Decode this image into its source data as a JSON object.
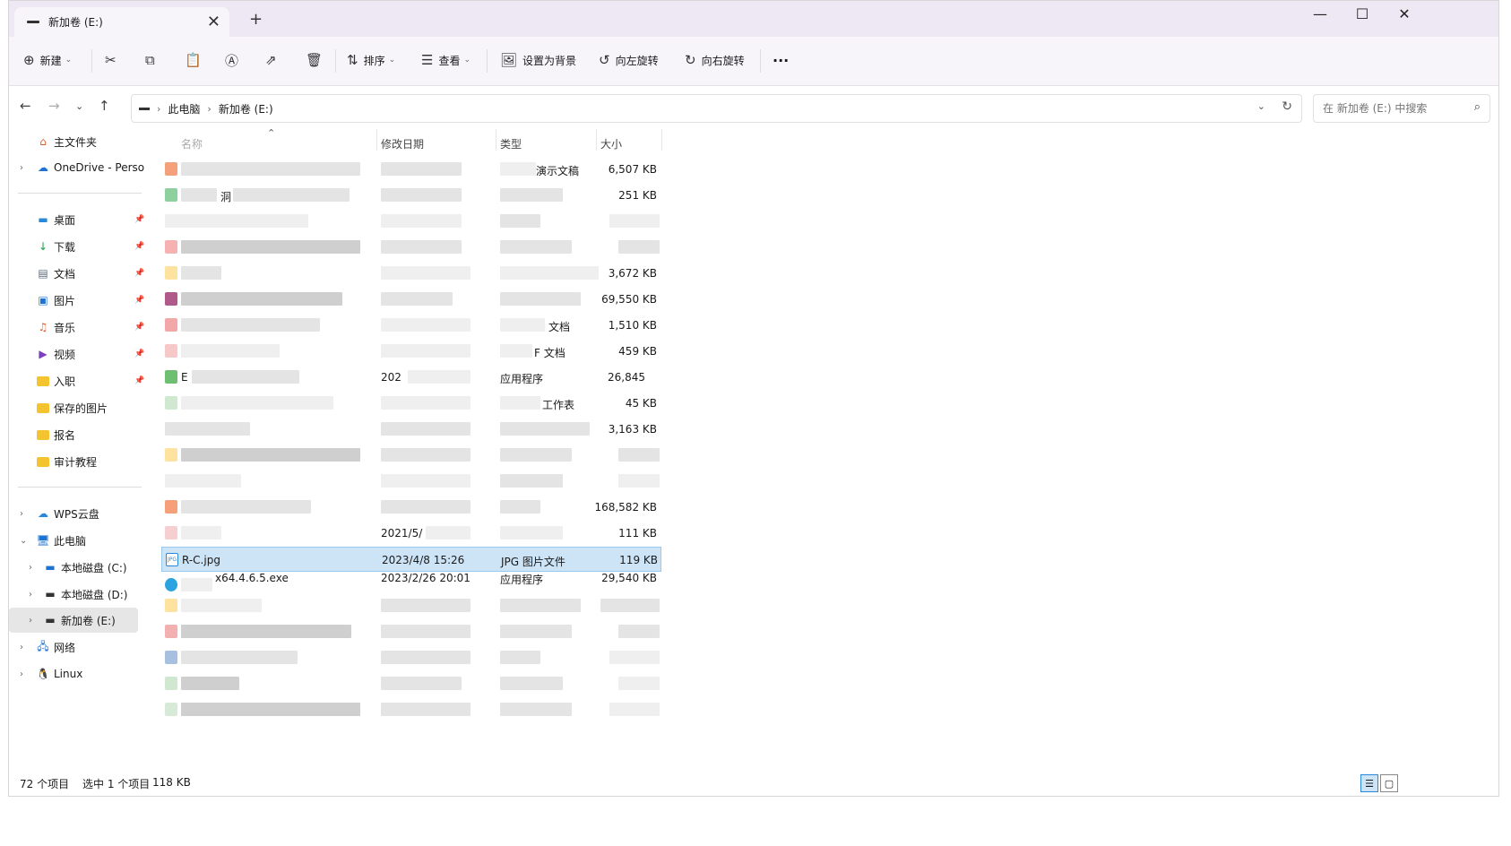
{
  "window": {
    "tab_title": "新加卷 (E:)",
    "new_tab": "+",
    "close_tab": "✕",
    "minimize": "—",
    "maximize": "☐",
    "close": "✕"
  },
  "toolbar": {
    "new_label": "新建",
    "sort_label": "排序",
    "view_label": "查看",
    "set_bg_label": "设置为背景",
    "rotate_left_label": "向左旋转",
    "rotate_right_label": "向右旋转",
    "more_label": "···"
  },
  "nav": {
    "breadcrumb": [
      "此电脑",
      "新加卷 (E:)"
    ],
    "search_placeholder": "在 新加卷 (E:) 中搜索"
  },
  "sidebar": {
    "home": "主文件夹",
    "onedrive": "OneDrive - Perso",
    "quick": [
      "桌面",
      "下载",
      "文档",
      "图片",
      "音乐",
      "视频",
      "入职",
      "保存的图片",
      "报名",
      "审计教程"
    ],
    "wps": "WPS云盘",
    "this_pc": "此电脑",
    "drive_c": "本地磁盘 (C:)",
    "drive_d": "本地磁盘 (D:)",
    "drive_e": "新加卷 (E:)",
    "network": "网络",
    "linux": "Linux"
  },
  "columns": {
    "name": "名称",
    "modified": "修改日期",
    "type": "类型",
    "size": "大小"
  },
  "rows": {
    "r0": {
      "type": "演示文稿",
      "size": "6,507 KB"
    },
    "r1": {
      "name": "洞",
      "size": "251 KB"
    },
    "r4": {
      "size": "3,672 KB"
    },
    "r5": {
      "size": "69,550 KB"
    },
    "r6": {
      "type": "文档",
      "size": "1,510 KB"
    },
    "r7": {
      "type": "F 文档",
      "size": "459 KB"
    },
    "r8": {
      "name": "E",
      "date": "202",
      "type": "应用程序",
      "size": "26,845"
    },
    "r9": {
      "type": "工作表",
      "size": "45 KB"
    },
    "r10": {
      "size": "3,163 KB"
    },
    "r13": {
      "size": "168,582 KB"
    },
    "r14": {
      "date": "2021/5/",
      "size": "111 KB"
    },
    "r15": {
      "name": "R-C.jpg",
      "date": "2023/4/8 15:26",
      "type": "JPG 图片文件",
      "size": "119 KB"
    },
    "r16": {
      "name": "x64.4.6.5.exe",
      "date": "2023/2/26 20:01",
      "type": "应用程序",
      "size": "29,540 KB"
    }
  },
  "status": {
    "count": "72 个项目",
    "selected": "选中 1 个项目",
    "sel_size": "118 KB"
  }
}
